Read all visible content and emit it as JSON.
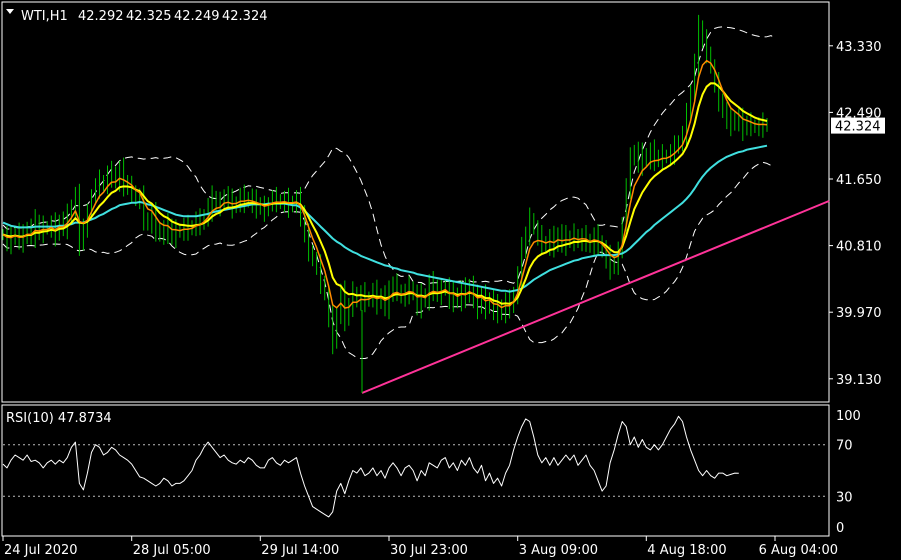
{
  "colors": {
    "background": "#000000",
    "frame": "#ffffff",
    "candles": "#00c000",
    "ma_fast": "#ff8c00",
    "ma_mid": "#ffff00",
    "ma_slow": "#40e0e0",
    "bands": "#ffffff",
    "trendline": "#ff3399",
    "rsi": "#ffffff",
    "price_tag_bg": "#ffffff",
    "price_tag_text": "#000000"
  },
  "chart_data": [
    {
      "type": "line",
      "title": "WTI,H1",
      "ohlc": [
        "42.292",
        "42.325",
        "42.249",
        "42.324"
      ],
      "current_price_label": "42.324",
      "current_price": 42.324,
      "y_ticks": [
        "43.330",
        "42.490",
        "41.650",
        "40.810",
        "39.970",
        "39.130"
      ],
      "y_tick_values": [
        43.33,
        42.49,
        41.65,
        40.81,
        39.97,
        39.13
      ],
      "ylim": [
        38.85,
        43.87
      ],
      "x_ticks": [
        "24 Jul 2020",
        "28 Jul 05:00",
        "29 Jul 14:00",
        "30 Jul 23:00",
        "3 Aug 09:00",
        "4 Aug 18:00",
        "6 Aug 04:00"
      ],
      "x_tick_index": [
        0,
        32,
        64,
        96,
        128,
        160,
        192
      ],
      "n_bars": 193,
      "series": [
        {
          "key": "close",
          "values": [
            40.95,
            40.85,
            40.9,
            40.98,
            40.88,
            40.92,
            41.02,
            40.95,
            41.1,
            40.98,
            41.05,
            41.02,
            41.08,
            40.95,
            41.12,
            41.05,
            41.18,
            41.3,
            41.42,
            40.85,
            41.05,
            41.2,
            41.45,
            41.55,
            41.62,
            41.58,
            41.7,
            41.72,
            41.62,
            41.75,
            41.6,
            41.55,
            41.5,
            41.38,
            41.42,
            41.15,
            41.08,
            41.2,
            41.02,
            40.95,
            41.0,
            41.05,
            40.92,
            41.0,
            40.98,
            41.05,
            41.02,
            41.05,
            41.12,
            41.1,
            41.18,
            41.28,
            41.4,
            41.35,
            41.32,
            41.45,
            41.38,
            41.3,
            41.35,
            41.42,
            41.38,
            41.4,
            41.35,
            41.32,
            41.3,
            41.25,
            41.35,
            41.4,
            41.38,
            41.35,
            41.38,
            41.32,
            41.35,
            41.38,
            41.22,
            40.95,
            40.75,
            40.62,
            40.55,
            40.35,
            40.2,
            39.9,
            39.6,
            39.95,
            40.2,
            39.9,
            40.05,
            40.22,
            40.1,
            40.2,
            40.12,
            40.15,
            40.22,
            40.1,
            40.18,
            40.05,
            40.2,
            40.32,
            40.25,
            40.15,
            40.22,
            40.28,
            40.2,
            40.05,
            40.18,
            40.12,
            40.32,
            40.28,
            40.2,
            40.25,
            40.3,
            40.12,
            40.2,
            40.1,
            40.25,
            40.18,
            40.3,
            40.15,
            40.05,
            40.18,
            40.02,
            40.15,
            39.98,
            40.05,
            39.95,
            40.1,
            40.05,
            40.2,
            40.42,
            40.75,
            40.95,
            41.15,
            41.02,
            40.92,
            40.85,
            40.8,
            40.9,
            40.82,
            40.95,
            40.85,
            40.9,
            40.88,
            40.95,
            40.85,
            40.92,
            40.88,
            40.8,
            40.92,
            40.85,
            40.75,
            40.65,
            40.55,
            40.58,
            40.72,
            41.1,
            41.55,
            41.9,
            42.0,
            41.85,
            41.95,
            41.9,
            41.98,
            41.92,
            41.9,
            41.95,
            41.92,
            41.98,
            42.05,
            42.12,
            42.2,
            42.45,
            42.75,
            43.1,
            43.55,
            43.4,
            43.25,
            43.05,
            42.85,
            42.65,
            42.5,
            42.4,
            42.35,
            42.42,
            42.38,
            42.3,
            42.35,
            42.33,
            42.3,
            42.32,
            42.34,
            42.324
          ]
        },
        {
          "key": "ma_slow",
          "values": [
            41.1,
            41.08,
            41.06,
            41.05,
            41.04,
            41.04,
            41.04,
            41.04,
            41.05,
            41.05,
            41.05,
            41.05,
            41.05,
            41.05,
            41.06,
            41.06,
            41.07,
            41.08,
            41.1,
            41.1,
            41.1,
            41.12,
            41.14,
            41.16,
            41.19,
            41.21,
            41.24,
            41.27,
            41.29,
            41.32,
            41.33,
            41.34,
            41.35,
            41.35,
            41.36,
            41.35,
            41.33,
            41.32,
            41.3,
            41.28,
            41.26,
            41.24,
            41.22,
            41.2,
            41.19,
            41.18,
            41.18,
            41.18,
            41.18,
            41.19,
            41.2,
            41.21,
            41.23,
            41.24,
            41.25,
            41.26,
            41.27,
            41.28,
            41.29,
            41.3,
            41.31,
            41.32,
            41.33,
            41.33,
            41.33,
            41.33,
            41.34,
            41.34,
            41.34,
            41.34,
            41.34,
            41.33,
            41.32,
            41.32,
            41.29,
            41.25,
            41.2,
            41.15,
            41.1,
            41.05,
            41.0,
            40.95,
            40.9,
            40.86,
            40.83,
            40.79,
            40.76,
            40.73,
            40.71,
            40.68,
            40.66,
            40.64,
            40.62,
            40.6,
            40.58,
            40.56,
            40.55,
            40.53,
            40.52,
            40.5,
            40.49,
            40.48,
            40.47,
            40.45,
            40.44,
            40.43,
            40.42,
            40.41,
            40.4,
            40.39,
            40.38,
            40.37,
            40.36,
            40.35,
            40.34,
            40.33,
            40.32,
            40.31,
            40.3,
            40.29,
            40.28,
            40.27,
            40.26,
            40.25,
            40.24,
            40.24,
            40.23,
            40.24,
            40.25,
            40.27,
            40.3,
            40.34,
            40.38,
            40.41,
            40.44,
            40.47,
            40.5,
            40.52,
            40.54,
            40.56,
            40.58,
            40.6,
            40.62,
            40.63,
            40.65,
            40.66,
            40.67,
            40.68,
            40.69,
            40.69,
            40.69,
            40.69,
            40.69,
            40.7,
            40.71,
            40.74,
            40.78,
            40.83,
            40.88,
            40.93,
            40.98,
            41.02,
            41.07,
            41.11,
            41.15,
            41.19,
            41.23,
            41.27,
            41.31,
            41.35,
            41.4,
            41.46,
            41.53,
            41.61,
            41.68,
            41.74,
            41.79,
            41.83,
            41.87,
            41.9,
            41.93,
            41.95,
            41.97,
            41.99,
            42.0,
            42.02,
            42.03,
            42.04,
            42.05,
            42.06,
            42.07
          ]
        }
      ]
    },
    {
      "type": "line",
      "title": "RSI(10) 47.8734",
      "y_ticks": [
        "100",
        "70",
        "30",
        "0"
      ],
      "y_tick_values": [
        100,
        70,
        30,
        0
      ],
      "levels": [
        70,
        30
      ],
      "ylim": [
        0,
        100
      ],
      "series": [
        {
          "key": "rsi",
          "values": [
            55,
            52,
            58,
            62,
            60,
            58,
            62,
            57,
            58,
            56,
            52,
            56,
            58,
            55,
            58,
            56,
            60,
            68,
            72,
            40,
            35,
            48,
            64,
            70,
            68,
            62,
            64,
            68,
            66,
            62,
            60,
            58,
            55,
            50,
            45,
            44,
            42,
            40,
            38,
            40,
            44,
            42,
            38,
            40,
            40,
            42,
            46,
            50,
            58,
            62,
            68,
            72,
            68,
            64,
            60,
            62,
            58,
            56,
            55,
            58,
            56,
            60,
            58,
            54,
            52,
            52,
            58,
            60,
            56,
            54,
            58,
            56,
            58,
            60,
            48,
            38,
            30,
            22,
            20,
            18,
            16,
            14,
            18,
            34,
            40,
            32,
            42,
            50,
            48,
            52,
            46,
            48,
            52,
            46,
            50,
            44,
            52,
            56,
            52,
            46,
            52,
            54,
            50,
            42,
            50,
            46,
            56,
            54,
            52,
            58,
            60,
            52,
            56,
            50,
            58,
            54,
            60,
            52,
            48,
            54,
            42,
            48,
            40,
            44,
            38,
            48,
            54,
            66,
            76,
            84,
            90,
            88,
            76,
            62,
            56,
            60,
            54,
            60,
            54,
            58,
            62,
            58,
            62,
            54,
            58,
            62,
            54,
            50,
            42,
            34,
            38,
            56,
            66,
            78,
            88,
            84,
            70,
            76,
            68,
            74,
            68,
            66,
            70,
            66,
            70,
            76,
            82,
            86,
            92,
            88,
            76,
            66,
            58,
            50,
            46,
            50,
            46,
            44,
            48,
            48,
            46,
            47,
            48,
            47.8734
          ]
        }
      ]
    }
  ]
}
